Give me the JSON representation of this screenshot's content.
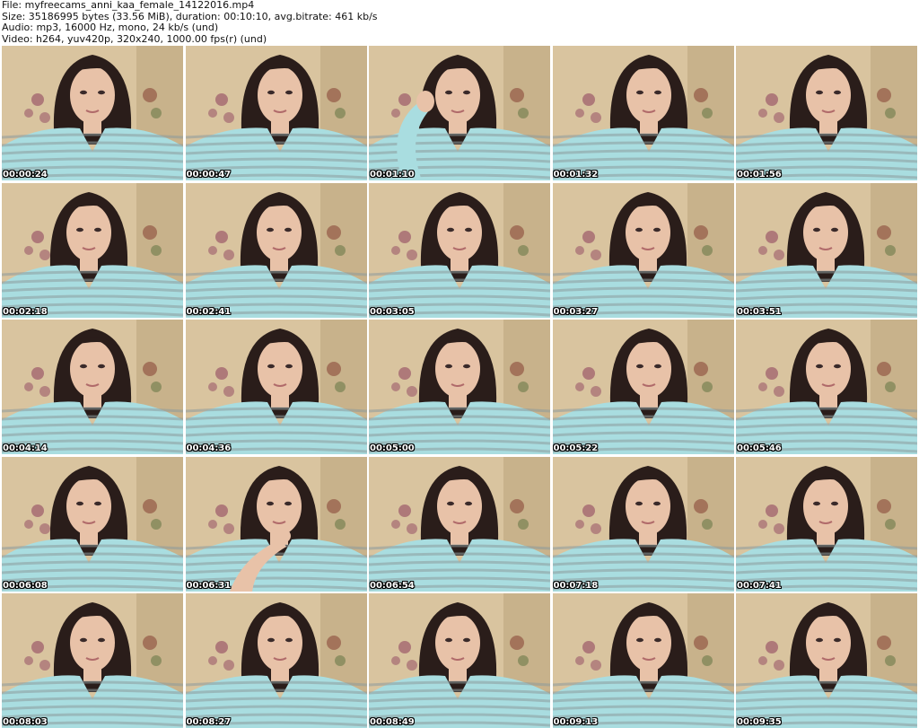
{
  "info": {
    "file": "File: myfreecams_anni_kaa_female_14122016.mp4",
    "size": "Size: 35186995 bytes (33.56 MiB), duration: 00:10:10, avg.bitrate: 461 kb/s",
    "audio": "Audio: mp3, 16000 Hz, mono, 24 kb/s (und)",
    "video": "Video: h264, yuv420p, 320x240, 1000.00 fps(r) (und)"
  },
  "colors": {
    "wall": "#d9c49f",
    "wall_shadow": "#b89f78",
    "hair": "#2a1d1a",
    "skin": "#e8c2a8",
    "shirt": "#a9dde0",
    "stripe": "#8c9a9c",
    "background_flowers": "#9b5a6a",
    "timestamp_text": "#ffffff"
  },
  "thumbnails": [
    {
      "time": "00:00:24",
      "pose": "center"
    },
    {
      "time": "00:00:47",
      "pose": "center"
    },
    {
      "time": "00:01:10",
      "pose": "hand-behind-head"
    },
    {
      "time": "00:01:32",
      "pose": "center"
    },
    {
      "time": "00:01:56",
      "pose": "center"
    },
    {
      "time": "00:02:18",
      "pose": "center"
    },
    {
      "time": "00:02:41",
      "pose": "center"
    },
    {
      "time": "00:03:05",
      "pose": "center"
    },
    {
      "time": "00:03:27",
      "pose": "center"
    },
    {
      "time": "00:03:51",
      "pose": "center"
    },
    {
      "time": "00:04:14",
      "pose": "center"
    },
    {
      "time": "00:04:36",
      "pose": "center"
    },
    {
      "time": "00:05:00",
      "pose": "center"
    },
    {
      "time": "00:05:22",
      "pose": "center"
    },
    {
      "time": "00:05:46",
      "pose": "center"
    },
    {
      "time": "00:06:08",
      "pose": "center"
    },
    {
      "time": "00:06:31",
      "pose": "hand-at-chin"
    },
    {
      "time": "00:06:54",
      "pose": "center"
    },
    {
      "time": "00:07:18",
      "pose": "center"
    },
    {
      "time": "00:07:41",
      "pose": "center"
    },
    {
      "time": "00:08:03",
      "pose": "center"
    },
    {
      "time": "00:08:27",
      "pose": "center"
    },
    {
      "time": "00:08:49",
      "pose": "center"
    },
    {
      "time": "00:09:13",
      "pose": "center"
    },
    {
      "time": "00:09:35",
      "pose": "center"
    }
  ]
}
